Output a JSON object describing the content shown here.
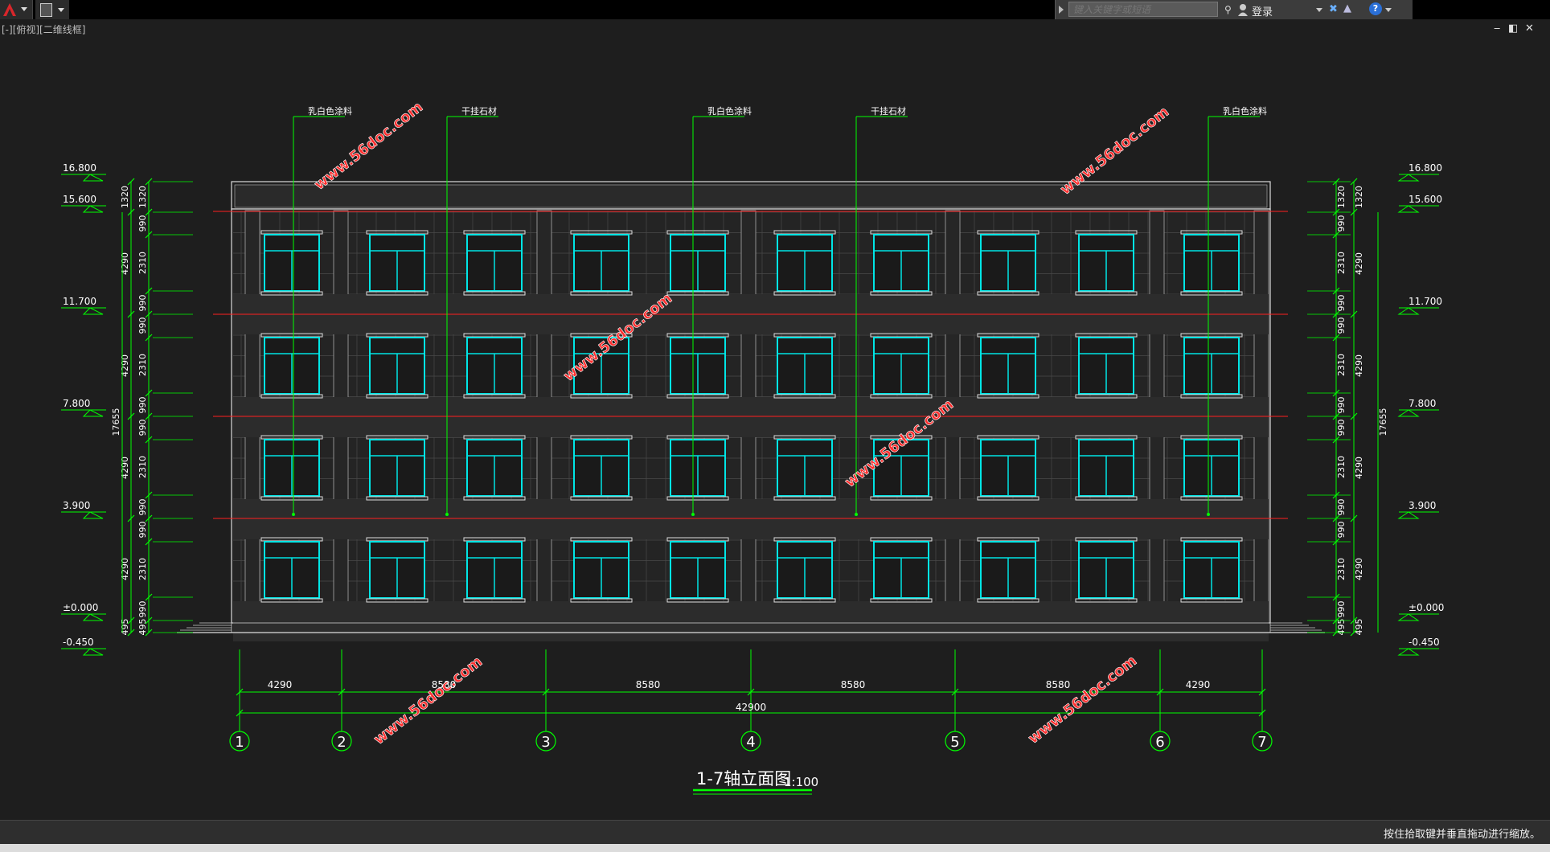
{
  "toolbar": {
    "search_placeholder": "键入关键字或短语",
    "login_label": "登录",
    "help_label": "?"
  },
  "viewport": {
    "view_label": "[-][俯视][二维线框]",
    "minimize": "‒",
    "restore": "◧",
    "close": "✕"
  },
  "drawing": {
    "title": "1-7轴立面图",
    "scale": "1:100",
    "material_callouts": [
      "乳白色涂料",
      "干挂石材",
      "乳白色涂料",
      "干挂石材",
      "乳白色涂料"
    ],
    "axis_labels": [
      "1",
      "2",
      "3",
      "4",
      "5",
      "6",
      "7"
    ],
    "axis_spacings": [
      "4290",
      "8580",
      "8580",
      "8580",
      "8580",
      "4290"
    ],
    "axis_total": "42900",
    "elevations": [
      "16.800",
      "15.600",
      "11.700",
      "7.800",
      "3.900",
      "±0.000",
      "-0.450"
    ],
    "vertical_dims_outer": [
      "1320",
      "4290",
      "4290",
      "4290",
      "4290",
      "495"
    ],
    "vertical_dims_inner": [
      "1320",
      "990",
      "2310",
      "990",
      "990",
      "2310",
      "990",
      "990",
      "2310",
      "990",
      "990",
      "2310",
      "990",
      "495"
    ],
    "total_height": "17655",
    "watermark": "www.56doc.com",
    "colors": {
      "background": "#1e1e1e",
      "dimension": "#00ff00",
      "window": "#00e5e5",
      "floor_line": "#ff2020",
      "outline": "#ffffff"
    }
  },
  "status": {
    "message": "按住拾取键并垂直拖动进行缩放。"
  }
}
